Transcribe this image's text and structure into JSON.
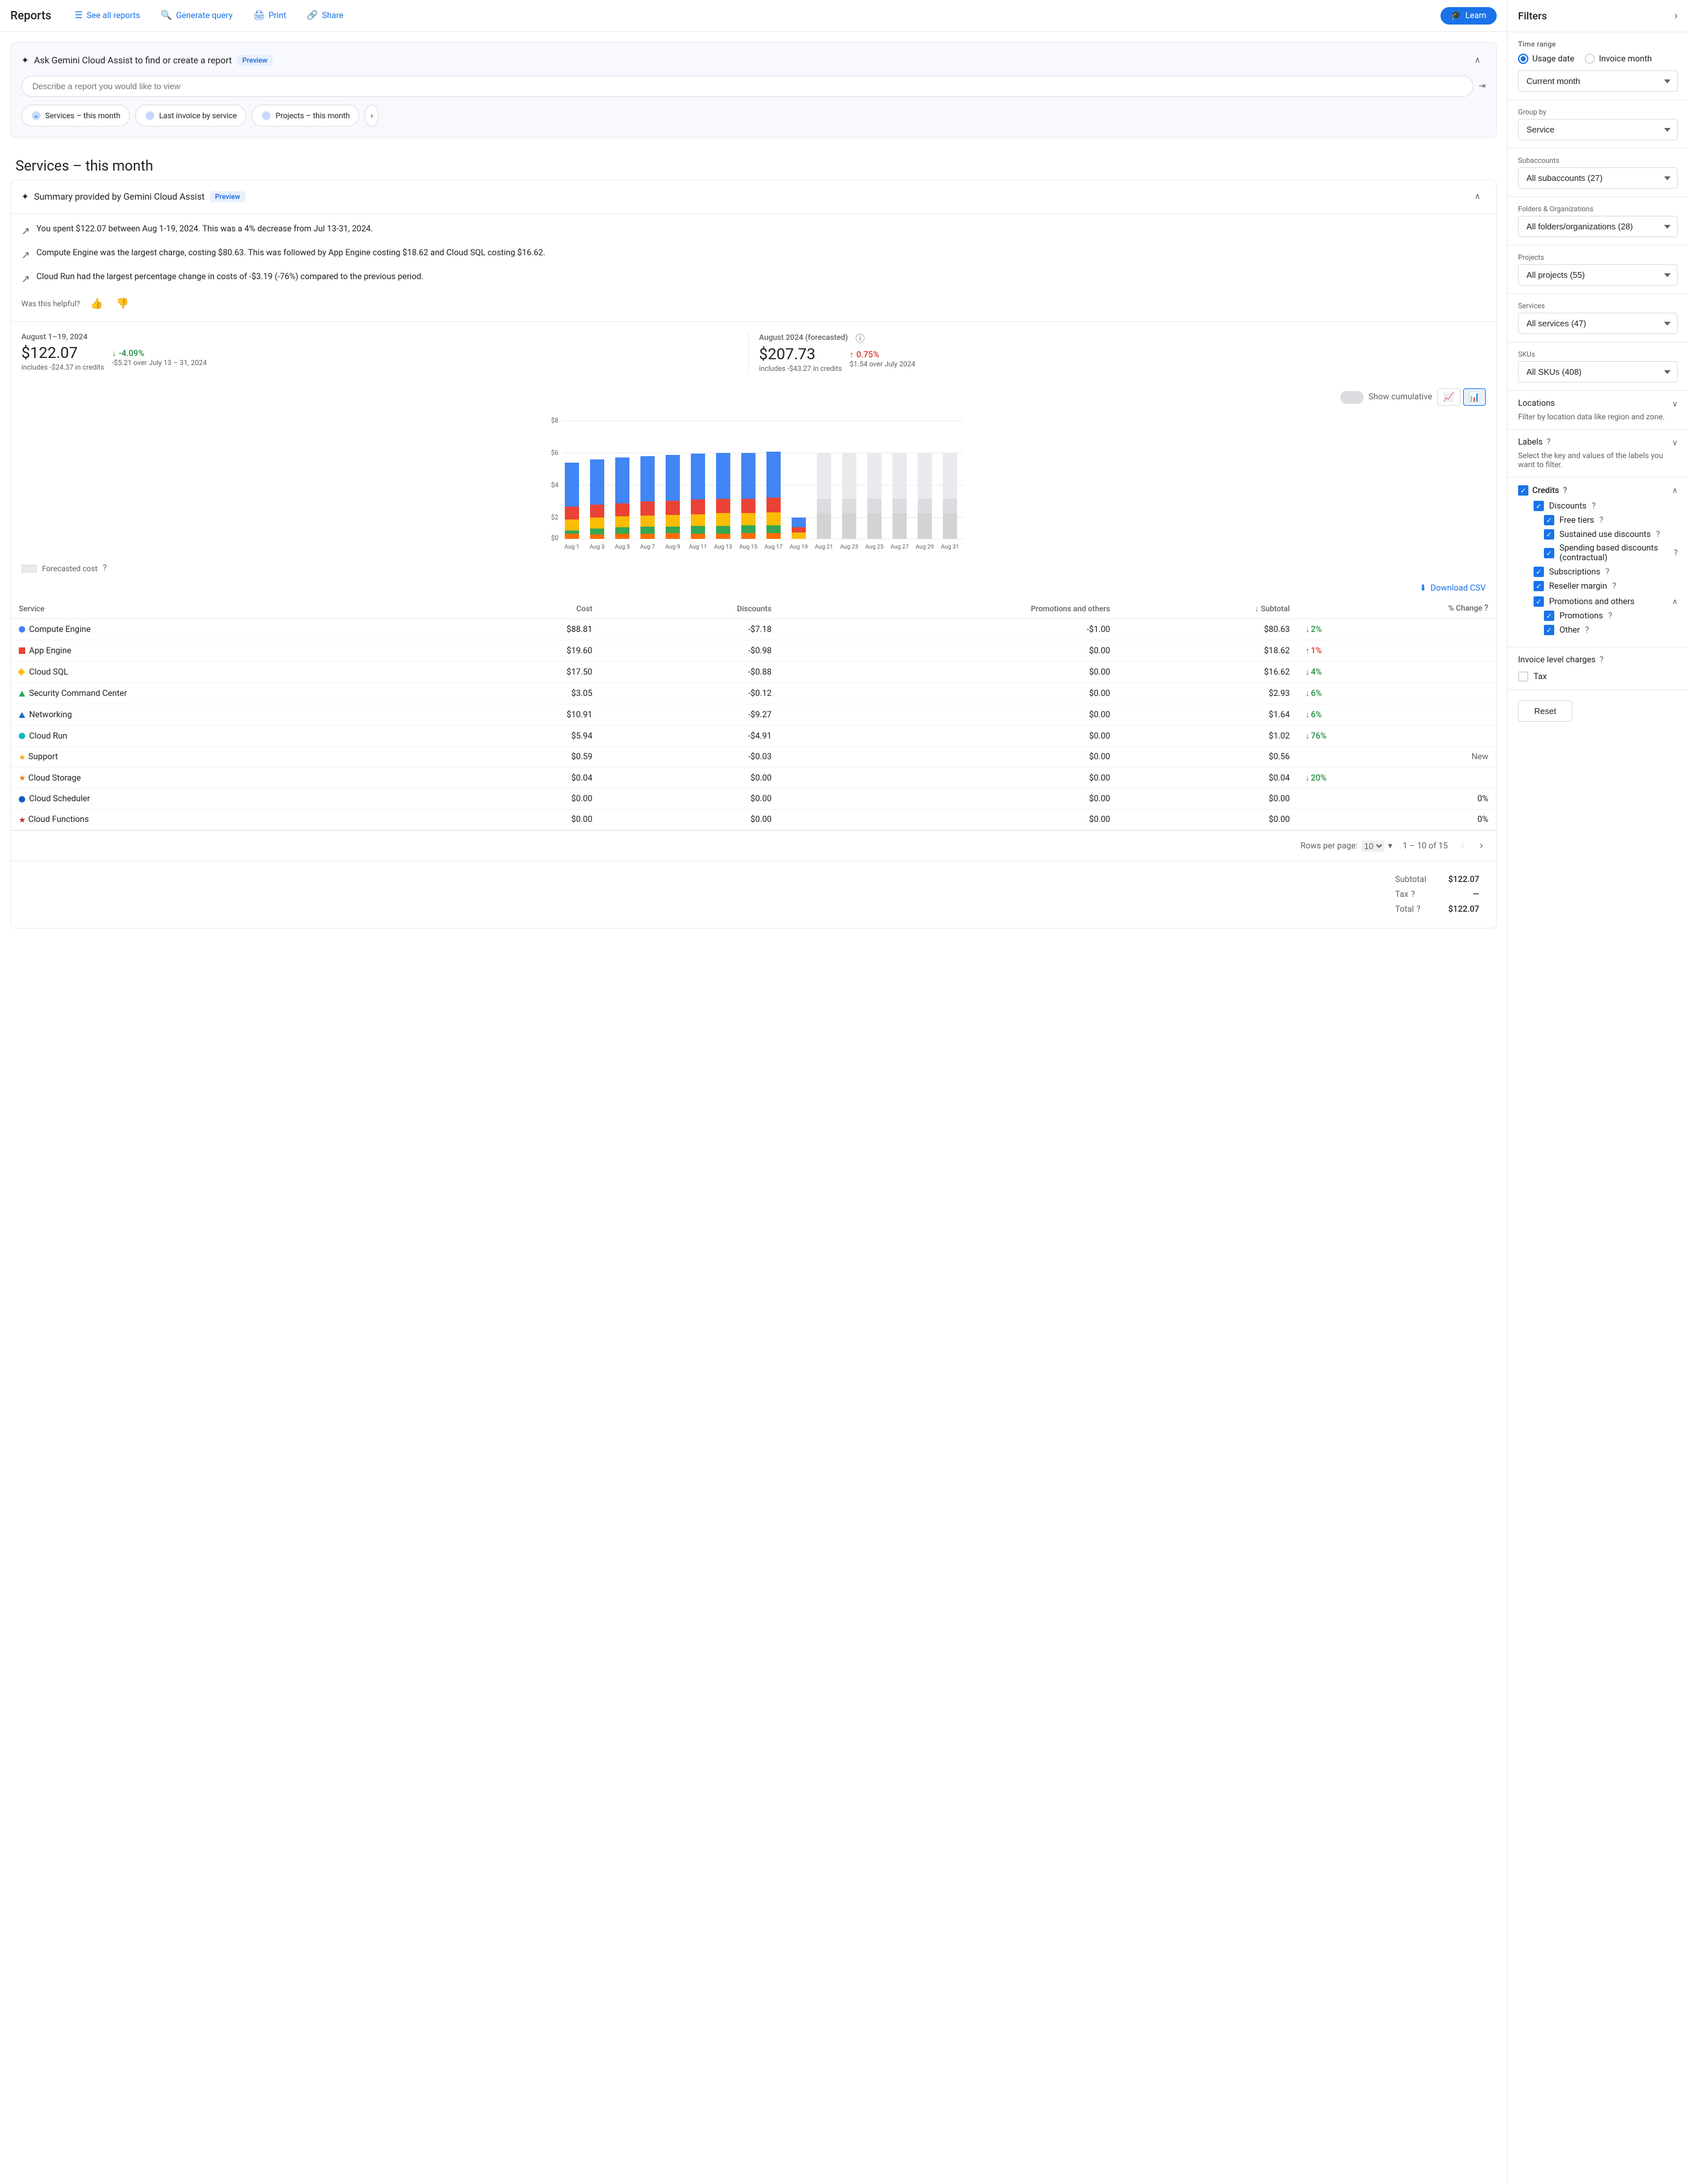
{
  "nav": {
    "title": "Reports",
    "links": [
      {
        "label": "See all reports",
        "icon": "☰"
      },
      {
        "label": "Generate query",
        "icon": "🔍"
      },
      {
        "label": "Print",
        "icon": "🖨"
      },
      {
        "label": "Share",
        "icon": "🔗"
      }
    ],
    "learn_label": "Learn",
    "learn_icon": "🎓"
  },
  "gemini": {
    "title": "Ask Gemini Cloud Assist to find or create a report",
    "preview_label": "Preview",
    "input_placeholder": "Describe a report you would like to view",
    "chips": [
      {
        "label": "Services – this month"
      },
      {
        "label": "Last invoice by service"
      },
      {
        "label": "Projects – this month"
      }
    ]
  },
  "page_title": "Services – this month",
  "summary": {
    "title": "Summary provided by Gemini Cloud Assist",
    "preview_label": "Preview",
    "items": [
      "You spent $122.07 between Aug 1-19, 2024. This was a 4% decrease from Jul 13-31, 2024.",
      "Compute Engine was the largest charge, costing $80.63. This was followed by App Engine costing $18.62 and Cloud SQL costing $16.62.",
      "Cloud Run had the largest percentage change in costs of -$3.19 (-76%) compared to the previous period."
    ],
    "helpful_label": "Was this helpful?"
  },
  "metrics": {
    "current": {
      "date": "August 1–19, 2024",
      "value": "$122.07",
      "sub": "includes -$24.37 in credits",
      "change": "-4.09%",
      "change_direction": "down",
      "change_sub": "-$5.21 over July 13 – 31, 2024"
    },
    "forecasted": {
      "date": "August 2024 (forecasted)",
      "value": "$207.73",
      "sub": "includes -$43.27 in credits",
      "change": "0.75%",
      "change_direction": "up",
      "change_sub": "$1.54 over July 2024"
    }
  },
  "chart": {
    "y_max_label": "$8",
    "y_labels": [
      "$8",
      "$6",
      "$4",
      "$2",
      "$0"
    ],
    "x_labels": [
      "Aug 1",
      "Aug 3",
      "Aug 5",
      "Aug 7",
      "Aug 9",
      "Aug 11",
      "Aug 13",
      "Aug 15",
      "Aug 17",
      "Aug 19",
      "Aug 21",
      "Aug 23",
      "Aug 25",
      "Aug 27",
      "Aug 29",
      "Aug 31"
    ],
    "show_cumulative_label": "Show cumulative",
    "forecasted_cost_label": "Forecasted cost"
  },
  "table": {
    "download_label": "Download CSV",
    "headers": [
      "Service",
      "Cost",
      "Discounts",
      "Promotions and others",
      "↓ Subtotal",
      "% Change"
    ],
    "rows": [
      {
        "color": "#4285f4",
        "shape": "circle",
        "name": "Compute Engine",
        "cost": "$88.81",
        "discounts": "-$7.18",
        "promotions": "-$1.00",
        "subtotal": "$80.63",
        "change": "2%",
        "change_dir": "down"
      },
      {
        "color": "#ea4335",
        "shape": "square",
        "name": "App Engine",
        "cost": "$19.60",
        "discounts": "-$0.98",
        "promotions": "$0.00",
        "subtotal": "$18.62",
        "change": "1%",
        "change_dir": "up"
      },
      {
        "color": "#fbbc04",
        "shape": "diamond",
        "name": "Cloud SQL",
        "cost": "$17.50",
        "discounts": "-$0.88",
        "promotions": "$0.00",
        "subtotal": "$16.62",
        "change": "4%",
        "change_dir": "down"
      },
      {
        "color": "#34a853",
        "shape": "triangle",
        "name": "Security Command Center",
        "cost": "$3.05",
        "discounts": "-$0.12",
        "promotions": "$0.00",
        "subtotal": "$2.93",
        "change": "6%",
        "change_dir": "down"
      },
      {
        "color": "#1967d2",
        "shape": "triangle",
        "name": "Networking",
        "cost": "$10.91",
        "discounts": "-$9.27",
        "promotions": "$0.00",
        "subtotal": "$1.64",
        "change": "6%",
        "change_dir": "down"
      },
      {
        "color": "#12b5cb",
        "shape": "circle",
        "name": "Cloud Run",
        "cost": "$5.94",
        "discounts": "-$4.91",
        "promotions": "$0.00",
        "subtotal": "$1.02",
        "change": "76%",
        "change_dir": "down"
      },
      {
        "color": "#f9ab00",
        "shape": "star",
        "name": "Support",
        "cost": "$0.59",
        "discounts": "-$0.03",
        "promotions": "$0.00",
        "subtotal": "$0.56",
        "change": "New",
        "change_dir": "new"
      },
      {
        "color": "#e37400",
        "shape": "star",
        "name": "Cloud Storage",
        "cost": "$0.04",
        "discounts": "$0.00",
        "promotions": "$0.00",
        "subtotal": "$0.04",
        "change": "20%",
        "change_dir": "down"
      },
      {
        "color": "#185abc",
        "shape": "circle",
        "name": "Cloud Scheduler",
        "cost": "$0.00",
        "discounts": "$0.00",
        "promotions": "$0.00",
        "subtotal": "$0.00",
        "change": "0%",
        "change_dir": "neutral"
      },
      {
        "color": "#c5221f",
        "shape": "star",
        "name": "Cloud Functions",
        "cost": "$0.00",
        "discounts": "$0.00",
        "promotions": "$0.00",
        "subtotal": "$0.00",
        "change": "0%",
        "change_dir": "neutral"
      }
    ],
    "pagination": {
      "rows_per_page_label": "Rows per page:",
      "rows_per_page": "10",
      "page_info": "1 – 10 of 15"
    },
    "totals": {
      "subtotal_label": "Subtotal",
      "subtotal_value": "$122.07",
      "tax_label": "Tax",
      "tax_value": "—",
      "total_label": "Total",
      "total_value": "$122.07"
    }
  },
  "filters": {
    "title": "Filters",
    "time_range_label": "Time range",
    "usage_date_label": "Usage date",
    "invoice_month_label": "Invoice month",
    "current_month_label": "Current month",
    "group_by_label": "Group by",
    "group_by_value": "Service",
    "subaccounts_label": "Subaccounts",
    "subaccounts_value": "All subaccounts (27)",
    "folders_label": "Folders & Organizations",
    "folders_value": "All folders/organizations (28)",
    "projects_label": "Projects",
    "projects_value": "All projects (55)",
    "services_label": "Services",
    "services_value": "All services (47)",
    "skus_label": "SKUs",
    "skus_value": "All SKUs (408)",
    "locations_label": "Locations",
    "locations_sub": "Filter by location data like region and zone.",
    "labels_label": "Labels",
    "labels_sub": "Select the key and values of the labels you want to filter.",
    "credits_label": "Credits",
    "discounts_label": "Discounts",
    "free_tiers_label": "Free tiers",
    "sustained_use_label": "Sustained use discounts",
    "spending_based_label": "Spending based discounts (contractual)",
    "subscriptions_label": "Subscriptions",
    "reseller_margin_label": "Reseller margin",
    "promotions_others_label": "Promotions and others",
    "promotions_label": "Promotions",
    "other_label": "Other",
    "invoice_charges_label": "Invoice level charges",
    "tax_label": "Tax",
    "reset_label": "Reset"
  }
}
